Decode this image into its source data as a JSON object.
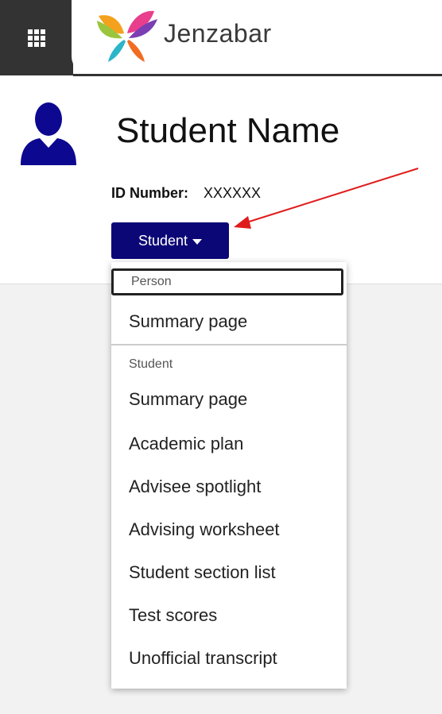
{
  "header": {
    "brand": "Jenzabar",
    "grid_icon": "apps-grid-icon"
  },
  "profile": {
    "name": "Student Name",
    "id_label": "ID Number:",
    "id_value": "XXXXXX",
    "role_button": "Student",
    "avatar_color": "#0c0890"
  },
  "menu": {
    "groups": [
      {
        "header": "Person",
        "items": [
          "Summary page"
        ]
      },
      {
        "header": "Student",
        "items": [
          "Summary page",
          "Academic plan",
          "Advisee spotlight",
          "Advising worksheet",
          "Student section list",
          "Test scores",
          "Unofficial transcript"
        ]
      }
    ]
  },
  "colors": {
    "accent": "#0c0776",
    "topbar_dark": "#333333",
    "arrow": "#e01b1b"
  }
}
